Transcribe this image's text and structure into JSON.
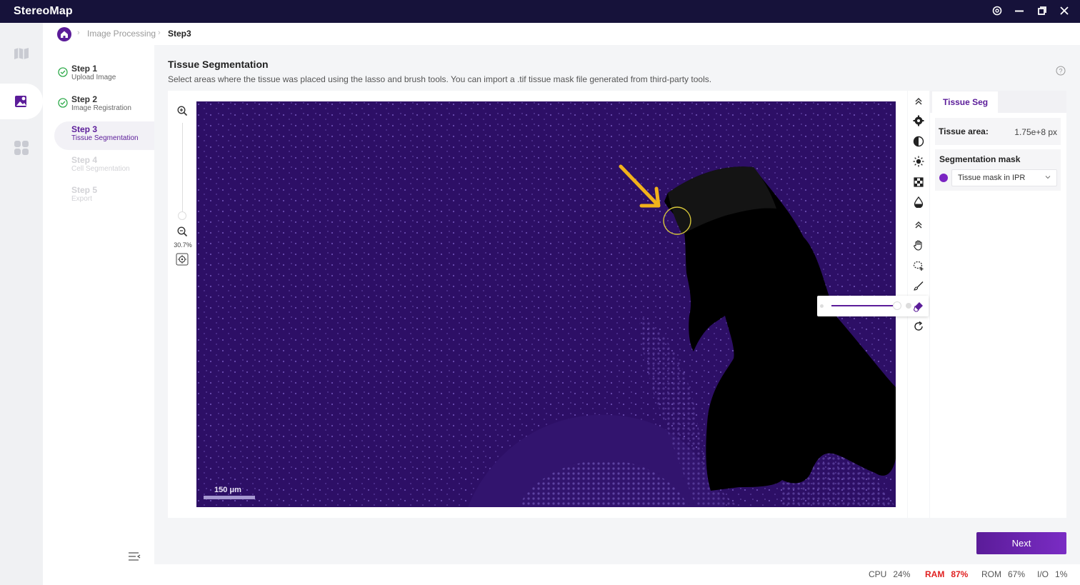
{
  "app": {
    "title": "StereoMap"
  },
  "titlebar": {
    "settings_icon": "gear-icon",
    "minimize_icon": "minimize-icon",
    "restore_icon": "restore-icon",
    "close_icon": "close-icon"
  },
  "rail": {
    "items": [
      "map-icon",
      "image-icon",
      "apps-icon"
    ],
    "active": "image-icon"
  },
  "breadcrumb": {
    "items": [
      "Image Processing",
      "Step3"
    ]
  },
  "steps": [
    {
      "title": "Step 1",
      "subtitle": "Upload Image",
      "state": "done"
    },
    {
      "title": "Step 2",
      "subtitle": "Image Registration",
      "state": "done"
    },
    {
      "title": "Step 3",
      "subtitle": "Tissue Segmentation",
      "state": "current"
    },
    {
      "title": "Step 4",
      "subtitle": "Cell Segmentation",
      "state": "disabled"
    },
    {
      "title": "Step 5",
      "subtitle": "Export",
      "state": "disabled"
    }
  ],
  "main": {
    "title": "Tissue Segmentation",
    "description": "Select areas where the tissue was placed using the lasso and brush tools. You can import a .tif tissue mask file generated from third-party tools."
  },
  "viewer": {
    "zoom_level": "30.7%",
    "scale_bar": "150 μm"
  },
  "tools": [
    "collapse-up-icon",
    "settings-cog-icon",
    "contrast-icon",
    "brightness-icon",
    "checker-icon",
    "opacity-drop-icon",
    "collapse-up-icon",
    "hand-pan-icon",
    "lasso-add-icon",
    "brush-icon",
    "eraser-icon",
    "reset-icon"
  ],
  "panel": {
    "tab": "Tissue Seg",
    "tissue_area_label": "Tissue area:",
    "tissue_area_value": "1.75e+8 px",
    "mask_label": "Segmentation mask",
    "mask_value": "Tissue mask in IPR"
  },
  "actions": {
    "next": "Next"
  },
  "status": {
    "cpu_label": "CPU",
    "cpu_value": "24%",
    "ram_label": "RAM",
    "ram_value": "87%",
    "rom_label": "ROM",
    "rom_value": "67%",
    "io_label": "I/O",
    "io_value": "1%"
  },
  "colors": {
    "accent": "#5b1c99",
    "titlebar": "#16123a",
    "image_bg": "#2d0f66",
    "callout": "#f2b21b",
    "ram_alert": "#e02020"
  }
}
